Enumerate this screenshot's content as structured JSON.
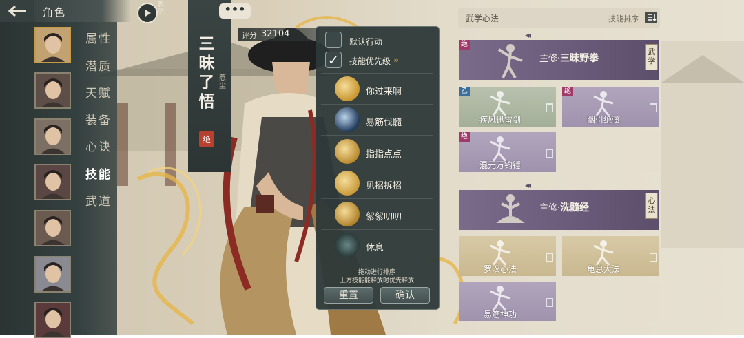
{
  "header": {
    "title": "角色",
    "tutorial_label": "教学"
  },
  "sidebar": {
    "menu": [
      {
        "label": "属性",
        "active": false
      },
      {
        "label": "潜质",
        "active": false
      },
      {
        "label": "天赋",
        "active": false
      },
      {
        "label": "装备",
        "active": false
      },
      {
        "label": "心诀",
        "active": false
      },
      {
        "label": "技能",
        "active": true
      },
      {
        "label": "武道",
        "active": false
      }
    ],
    "portrait_count": 7
  },
  "character": {
    "banner_name": "三昧了悟",
    "banner_subtitle": "惹尘",
    "banner_seal": "绝",
    "score_label": "评分",
    "score_value": "32104",
    "chat_bubble": "•••"
  },
  "popup": {
    "default_action": {
      "label": "默认行动",
      "checked": false
    },
    "skill_priority": {
      "label": "技能优先级",
      "checked": true,
      "chevron": "»"
    },
    "skills": [
      {
        "name": "你过来啊",
        "icon": "gold-swirl-icon"
      },
      {
        "name": "易筋伐髓",
        "icon": "blue-crescent-icon"
      },
      {
        "name": "指指点点",
        "icon": "gold-finger-icon"
      },
      {
        "name": "见招拆招",
        "icon": "gold-burst-icon"
      },
      {
        "name": "絮絮叨叨",
        "icon": "gold-fist-icon"
      },
      {
        "name": "休息",
        "icon": "meditation-icon"
      }
    ],
    "hint_line1": "拖动进行排序",
    "hint_line2": "上方技能能释放时优先释放",
    "reset_label": "重置",
    "confirm_label": "确认"
  },
  "martial": {
    "title": "武学心法",
    "sort_label": "技能排序",
    "primary1": {
      "prefix": "主修·",
      "name": "三昧野拳",
      "type_tag": "武学",
      "corner": "绝"
    },
    "primary1_skills": [
      {
        "name": "疾风迅雷剑",
        "rarity": "green",
        "corner": "乙"
      },
      {
        "name": "幽引绝弦",
        "rarity": "purple",
        "corner": "绝"
      },
      {
        "name": "混元万钧锤",
        "rarity": "purple",
        "corner": "绝"
      },
      {
        "name": "",
        "rarity": "empty"
      }
    ],
    "primary2": {
      "prefix": "主修·",
      "name": "洗髓经",
      "type_tag": "心法"
    },
    "primary2_skills": [
      {
        "name": "罗汉心法",
        "rarity": "tan"
      },
      {
        "name": "龟息大法",
        "rarity": "tan"
      },
      {
        "name": "易筋神功",
        "rarity": "purple"
      },
      {
        "name": "",
        "rarity": "empty"
      }
    ]
  },
  "colors": {
    "accent_gold": "#c79b45",
    "panel_dark": "#2d3939",
    "purple": "#6c5d7c",
    "seal_red": "#b8402f"
  }
}
